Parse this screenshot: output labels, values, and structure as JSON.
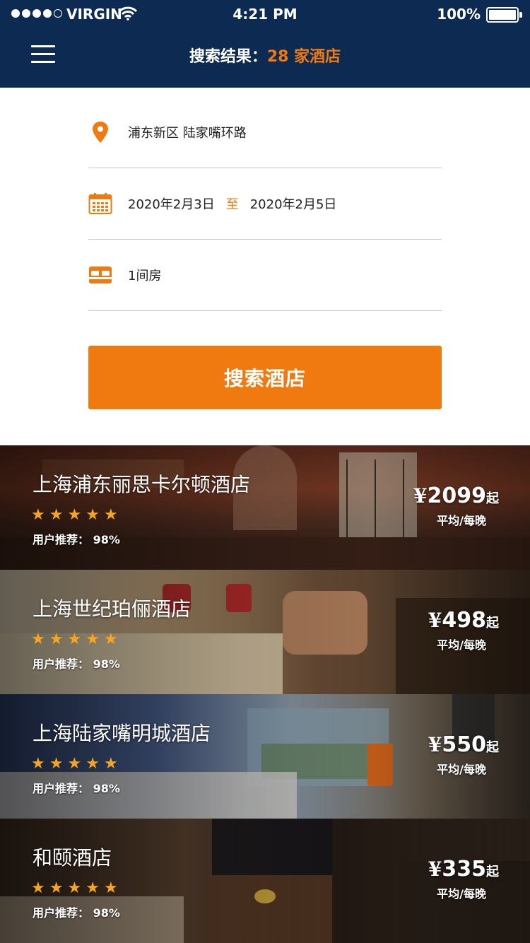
{
  "status_bar": {
    "carrier": "VIRGIN",
    "time": "4:21 PM",
    "battery": "100%"
  },
  "header": {
    "title_prefix": "搜索结果：",
    "title_count": "28 家酒店",
    "menu_icon": "hamburger-menu-icon"
  },
  "search": {
    "location": "浦东新区 陆家嘴环路",
    "checkin": "2020年2月3日",
    "separator": "至",
    "checkout": "2020年2月5日",
    "rooms": "1间房",
    "button_label": "搜索酒店",
    "icons": [
      "location-pin-icon",
      "calendar-icon",
      "bed-icon"
    ]
  },
  "colors": {
    "header_bg": "#0c2a52",
    "accent": "#f07a10",
    "star": "#f7a51c"
  },
  "hotels": [
    {
      "name": "上海浦东丽思卡尔顿酒店",
      "stars": "★★★★★",
      "recommend": "用户推荐： 98%",
      "currency": "¥",
      "price": "2099",
      "from": "起",
      "unit": "平均/每晚"
    },
    {
      "name": "上海世纪珀俪酒店",
      "stars": "★★★★★",
      "recommend": "用户推荐： 98%",
      "currency": "¥",
      "price": "498",
      "from": "起",
      "unit": "平均/每晚"
    },
    {
      "name": "上海陆家嘴明城酒店",
      "stars": "★★★★★",
      "recommend": "用户推荐： 98%",
      "currency": "¥",
      "price": "550",
      "from": "起",
      "unit": "平均/每晚"
    },
    {
      "name": "和颐酒店",
      "stars": "★★★★★",
      "recommend": "用户推荐： 98%",
      "currency": "¥",
      "price": "335",
      "from": "起",
      "unit": "平均/每晚"
    }
  ]
}
